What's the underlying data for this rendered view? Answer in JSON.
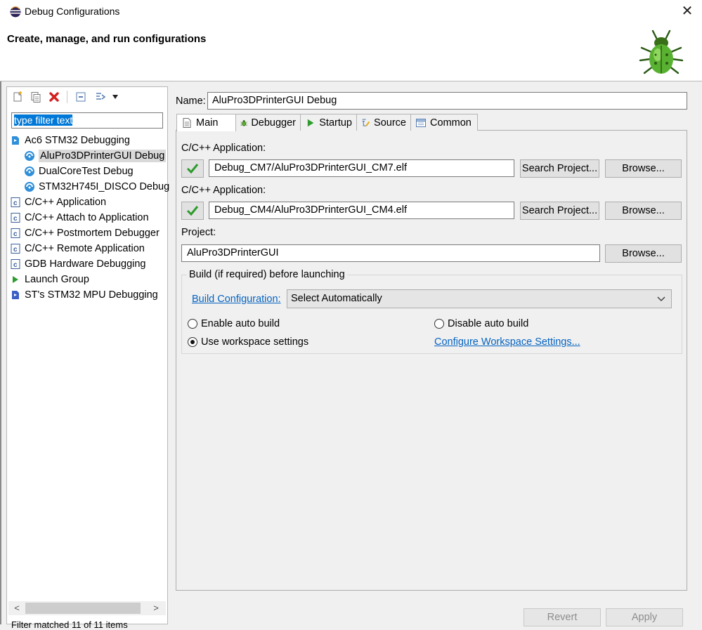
{
  "window": {
    "title": "Debug Configurations",
    "banner_title": "Create, manage, and run configurations"
  },
  "left_panel": {
    "filter_value": "type filter text",
    "tree": [
      {
        "label": "Ac6 STM32 Debugging",
        "level": 0,
        "icon": "stm32-debug-icon"
      },
      {
        "label": "AluPro3DPrinterGUI Debug",
        "level": 1,
        "icon": "debug-config-icon",
        "selected": true
      },
      {
        "label": "DualCoreTest Debug",
        "level": 1,
        "icon": "debug-config-icon"
      },
      {
        "label": "STM32H745I_DISCO Debug",
        "level": 1,
        "icon": "debug-config-icon"
      },
      {
        "label": "C/C++ Application",
        "level": 0,
        "icon": "c-app-icon"
      },
      {
        "label": "C/C++ Attach to Application",
        "level": 0,
        "icon": "c-app-icon"
      },
      {
        "label": "C/C++ Postmortem Debugger",
        "level": 0,
        "icon": "c-app-icon"
      },
      {
        "label": "C/C++ Remote Application",
        "level": 0,
        "icon": "c-app-icon"
      },
      {
        "label": "GDB Hardware Debugging",
        "level": 0,
        "icon": "c-app-icon"
      },
      {
        "label": "Launch Group",
        "level": 0,
        "icon": "launch-group-icon"
      },
      {
        "label": "ST's STM32 MPU Debugging",
        "level": 0,
        "icon": "mpu-debug-icon"
      }
    ],
    "status": "Filter matched 11 of 11 items"
  },
  "config": {
    "name_label": "Name:",
    "name_value": "AluPro3DPrinterGUI Debug",
    "tabs": [
      {
        "label": "Main",
        "icon": "main-tab-icon"
      },
      {
        "label": "Debugger",
        "icon": "debugger-bug-icon"
      },
      {
        "label": "Startup",
        "icon": "startup-play-icon"
      },
      {
        "label": "Source",
        "icon": "source-icon"
      },
      {
        "label": "Common",
        "icon": "common-icon"
      }
    ],
    "app1_label": "C/C++ Application:",
    "app1_value": "Debug_CM7/AluPro3DPrinterGUI_CM7.elf",
    "app2_label": "C/C++ Application:",
    "app2_value": "Debug_CM4/AluPro3DPrinterGUI_CM4.elf",
    "search_project_label": "Search Project...",
    "browse_label": "Browse...",
    "project_label": "Project:",
    "project_value": "AluPro3DPrinterGUI",
    "build_group_title": "Build (if required) before launching",
    "build_config_link": "Build Configuration:",
    "build_config_value": "Select Automatically",
    "radio_enable": "Enable auto build",
    "radio_disable": "Disable auto build",
    "radio_workspace": "Use workspace settings",
    "configure_link": "Configure Workspace Settings...",
    "selected_radio": "workspace"
  },
  "bottom": {
    "revert_label": "Revert",
    "apply_label": "Apply"
  },
  "colors": {
    "link": "#0563c1",
    "selection": "#0078d7",
    "check_green": "#2e9b2e"
  }
}
